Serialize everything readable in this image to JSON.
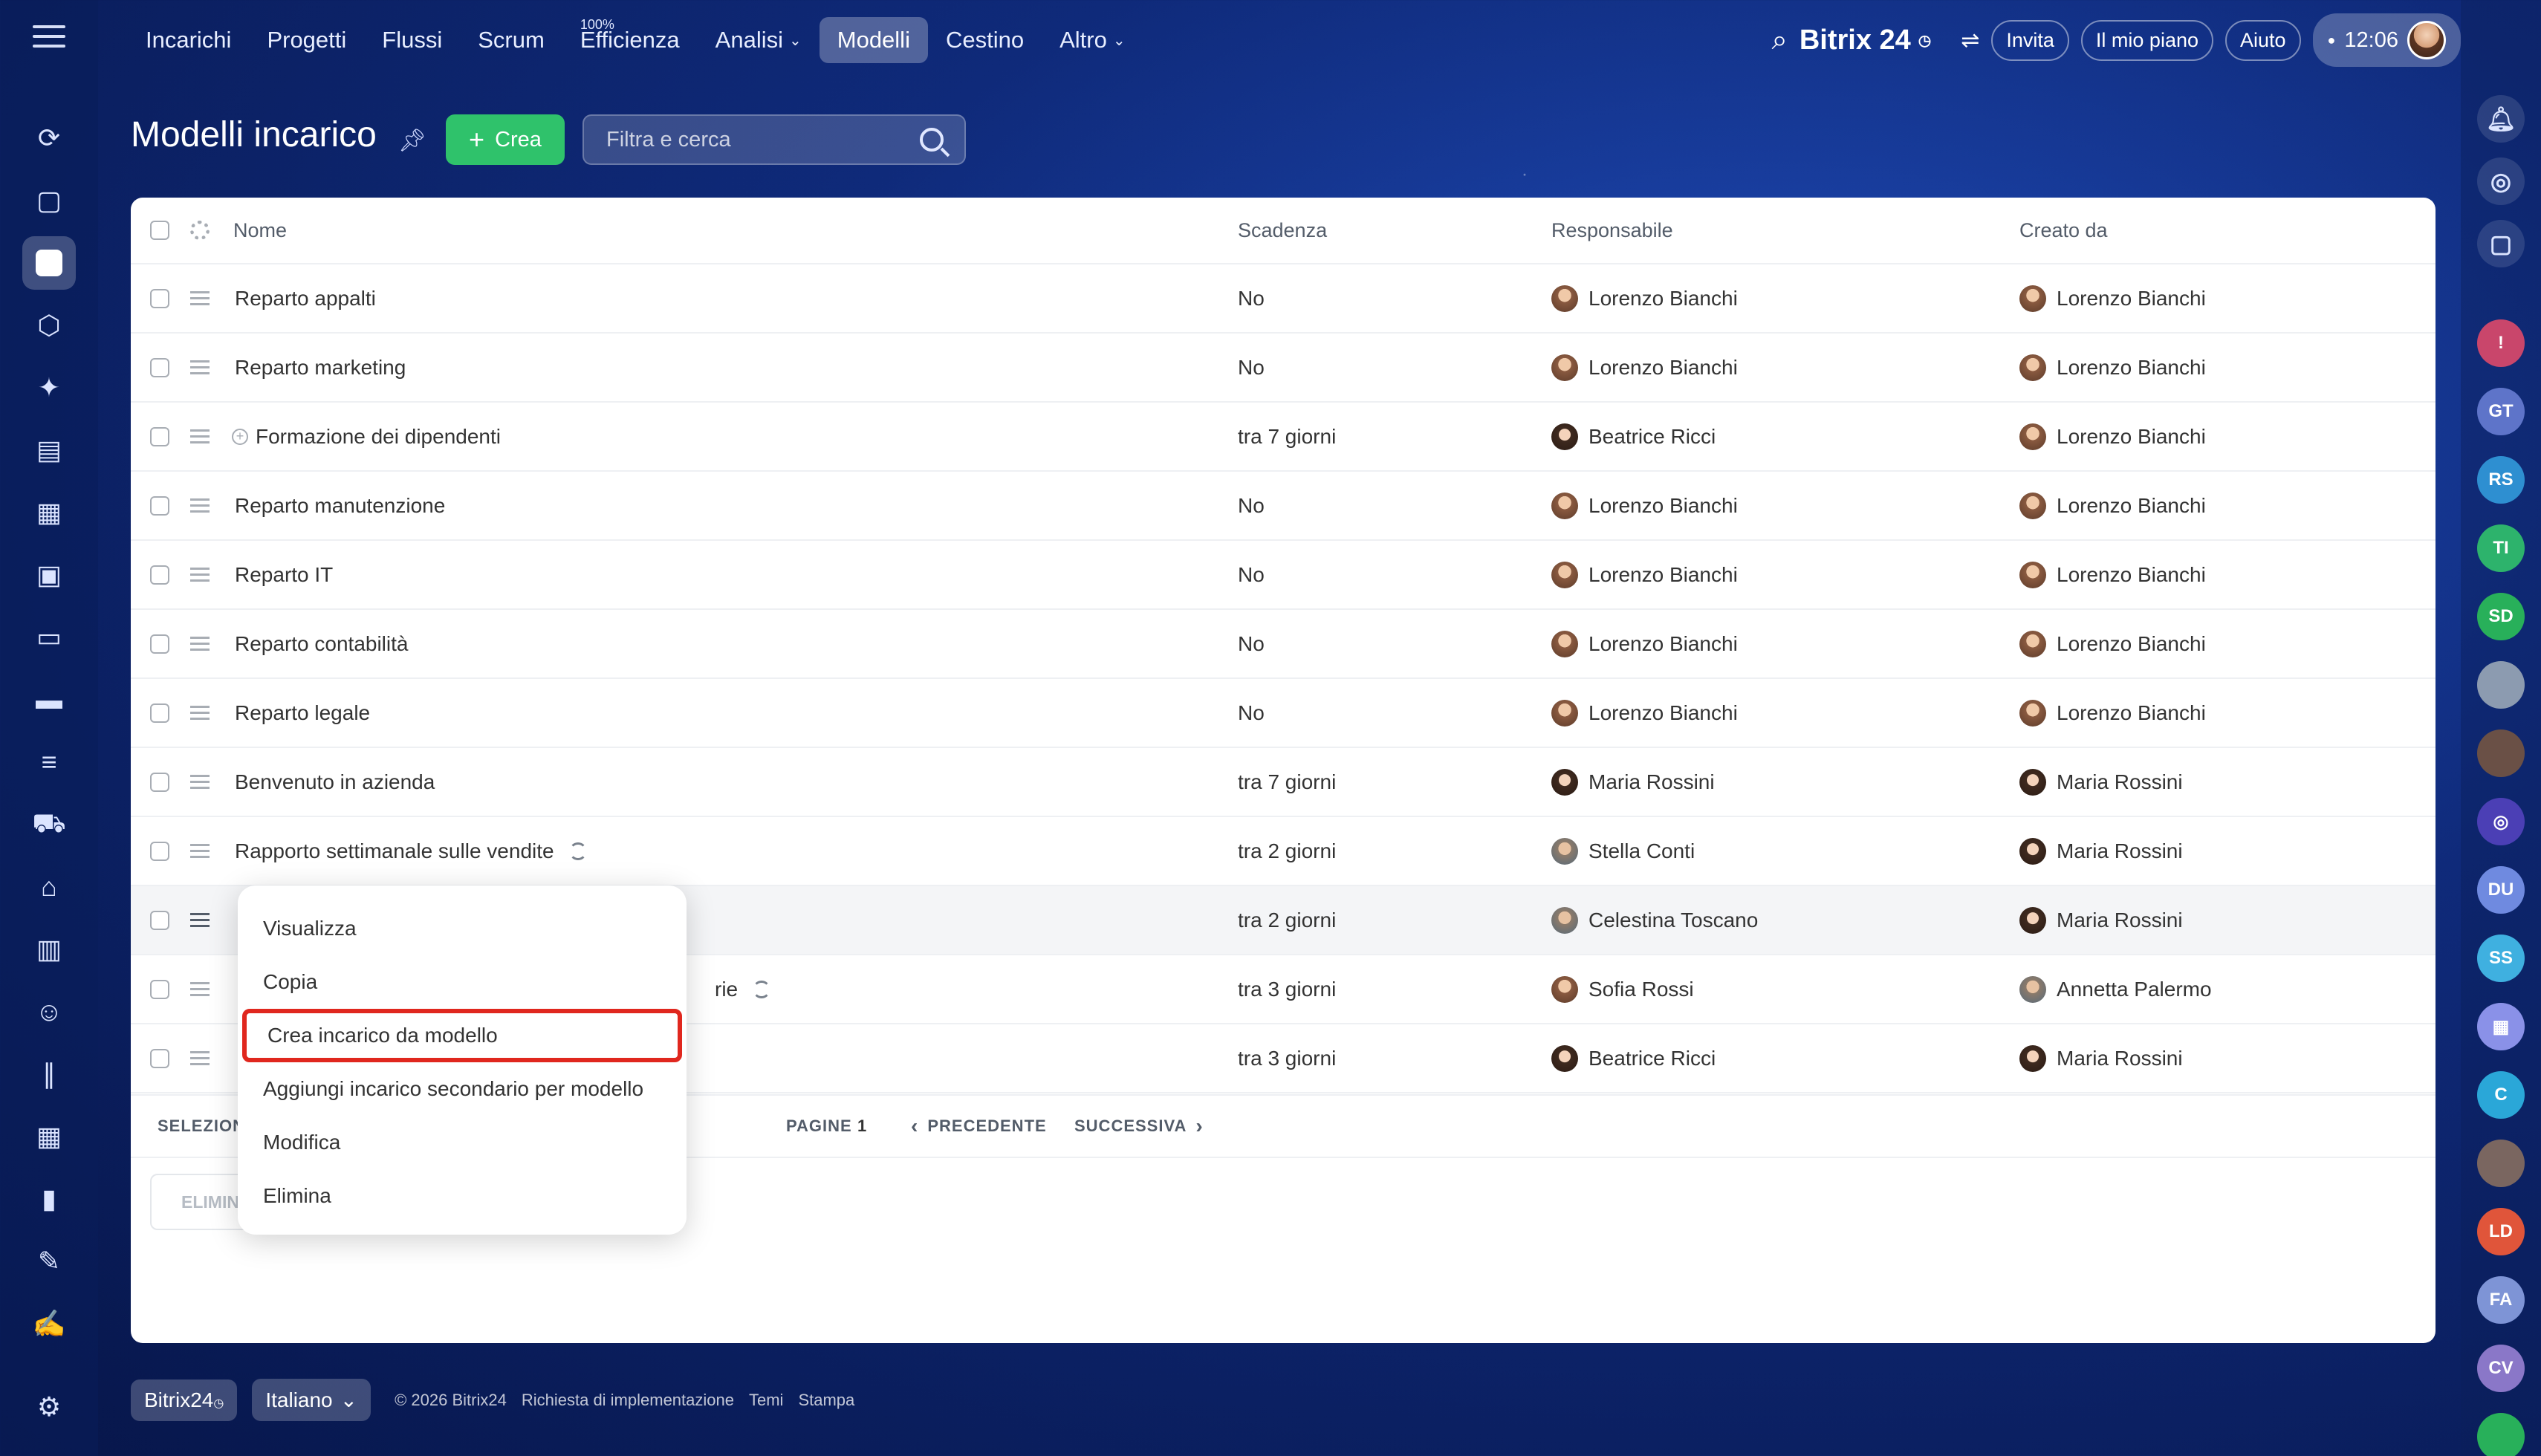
{
  "nav": {
    "items": [
      "Incarichi",
      "Progetti",
      "Flussi",
      "Scrum",
      "Efficienza",
      "Analisi",
      "Modelli",
      "Cestino",
      "Altro"
    ],
    "efficiency_badge": "100%",
    "brand": "Bitrix 24",
    "invite": "Invita",
    "plan": "Il mio piano",
    "help": "Aiuto",
    "time": "12:06"
  },
  "header": {
    "title": "Modelli incarico",
    "create_label": "Crea",
    "search_placeholder": "Filtra e cerca"
  },
  "table": {
    "columns": [
      "Nome",
      "Scadenza",
      "Responsabile",
      "Creato da"
    ],
    "rows": [
      {
        "name": "Reparto appalti",
        "deadline": "No",
        "responsible": "Lorenzo Bianchi",
        "creator": "Lorenzo Bianchi"
      },
      {
        "name": "Reparto marketing",
        "deadline": "No",
        "responsible": "Lorenzo Bianchi",
        "creator": "Lorenzo Bianchi"
      },
      {
        "name": "Formazione dei dipendenti",
        "deadline": "tra 7 giorni",
        "responsible": "Beatrice Ricci",
        "creator": "Lorenzo Bianchi"
      },
      {
        "name": "Reparto manutenzione",
        "deadline": "No",
        "responsible": "Lorenzo Bianchi",
        "creator": "Lorenzo Bianchi"
      },
      {
        "name": "Reparto IT",
        "deadline": "No",
        "responsible": "Lorenzo Bianchi",
        "creator": "Lorenzo Bianchi"
      },
      {
        "name": "Reparto contabilità",
        "deadline": "No",
        "responsible": "Lorenzo Bianchi",
        "creator": "Lorenzo Bianchi"
      },
      {
        "name": "Reparto legale",
        "deadline": "No",
        "responsible": "Lorenzo Bianchi",
        "creator": "Lorenzo Bianchi"
      },
      {
        "name": "Benvenuto in azienda",
        "deadline": "tra 7 giorni",
        "responsible": "Maria Rossini",
        "creator": "Maria Rossini"
      },
      {
        "name": "Rapporto settimanale sulle vendite",
        "deadline": "tra 2 giorni",
        "responsible": "Stella Conti",
        "creator": "Maria Rossini"
      },
      {
        "name": "",
        "deadline": "tra 2 giorni",
        "responsible": "Celestina Toscano",
        "creator": "Maria Rossini"
      },
      {
        "name": "rie",
        "deadline": "tra 3 giorni",
        "responsible": "Sofia Rossi",
        "creator": "Annetta Palermo"
      },
      {
        "name": "",
        "deadline": "tra 3 giorni",
        "responsible": "Beatrice Ricci",
        "creator": "Maria Rossini"
      }
    ]
  },
  "pagination": {
    "selected_label": "SELEZION",
    "pages_label": "PAGINE",
    "page": "1",
    "prev": "PRECEDENTE",
    "next": "SUCCESSIVA"
  },
  "delete_button": "ELIMIN",
  "context_menu": {
    "items": [
      "Visualizza",
      "Copia",
      "Crea incarico da modello",
      "Aggiungi incarico secondario per modello",
      "Modifica",
      "Elimina"
    ]
  },
  "footer": {
    "brand": "Bitrix24",
    "language": "Italiano",
    "copyright": "© 2026 Bitrix24",
    "links": [
      "Richiesta di implementazione",
      "Temi",
      "Stampa"
    ]
  },
  "right_bar": {
    "initials": [
      "GT",
      "RS",
      "TI",
      "SD",
      "DU",
      "SS",
      "C",
      "LD",
      "FA",
      "CV"
    ]
  },
  "colors": {
    "accent_green": "#2fc26b",
    "highlight_red": "#e0271e",
    "background_blue": "#0f2a7a"
  }
}
